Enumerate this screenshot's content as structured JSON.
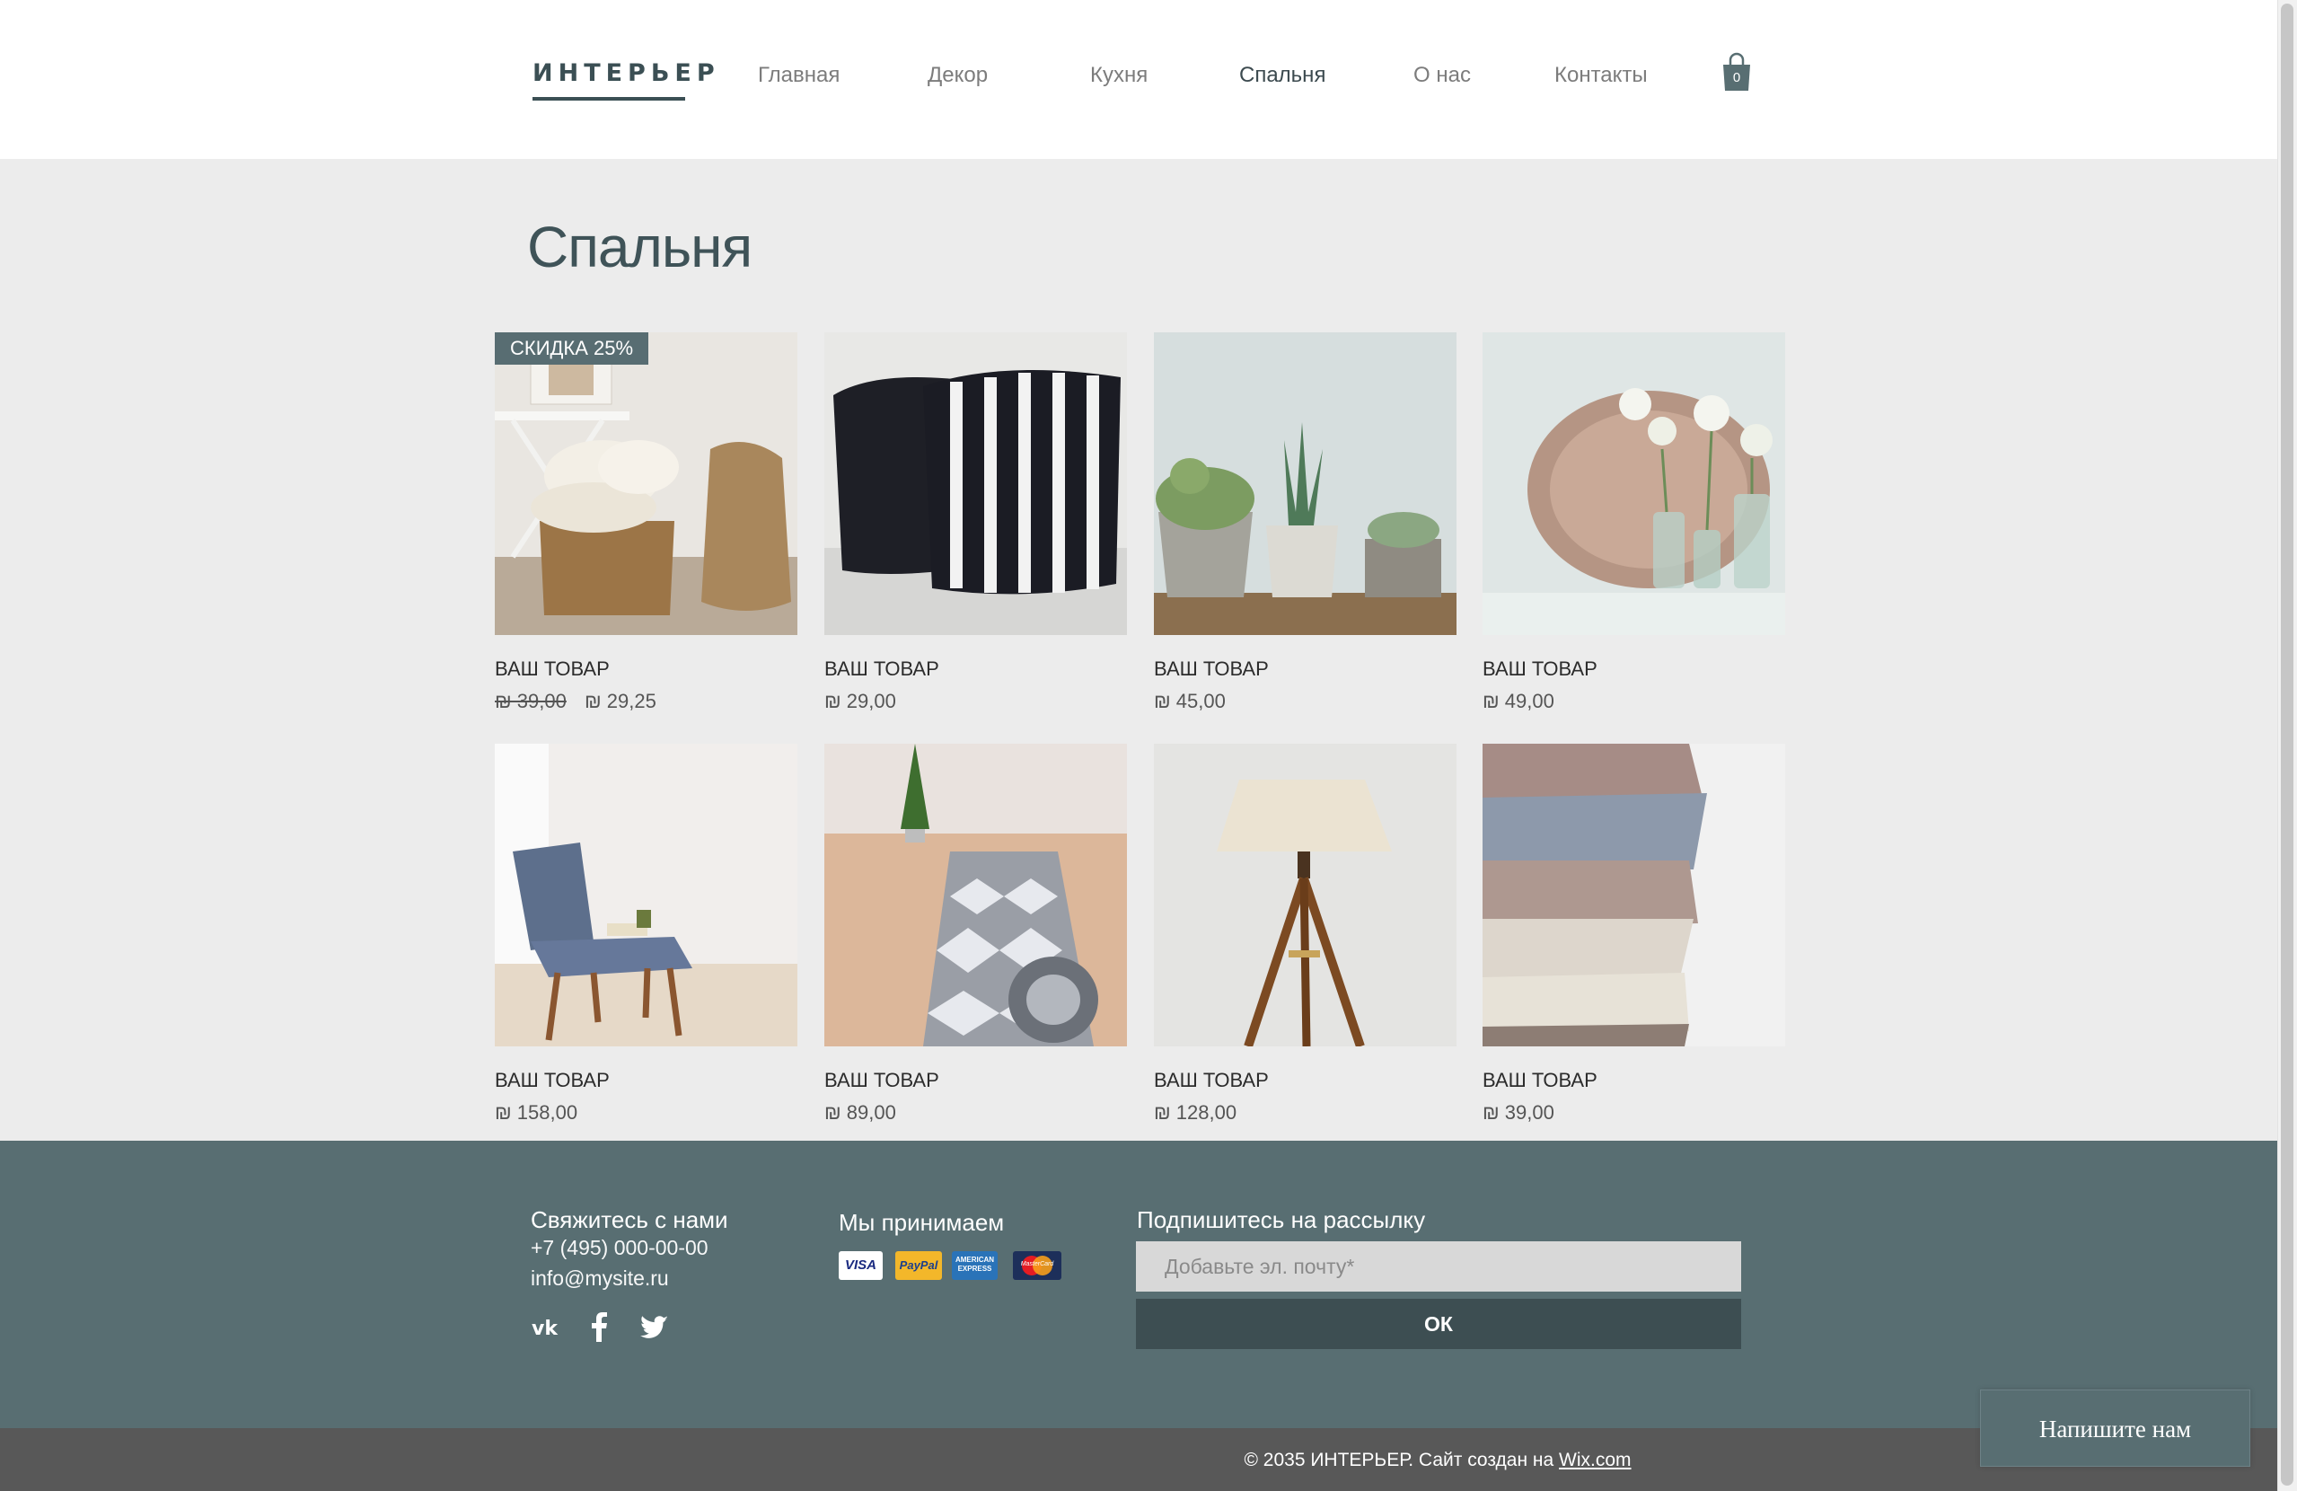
{
  "header": {
    "logo": "ИНТЕРЬЕР",
    "nav": [
      "Главная",
      "Декор",
      "Кухня",
      "Спальня",
      "О нас",
      "Контакты"
    ],
    "active_nav": "Спальня",
    "cart_count": "0"
  },
  "main": {
    "title": "Спальня",
    "products": [
      {
        "name": "ВАШ ТОВАР",
        "old_price": "₪ 39,00",
        "price": "₪ 29,25",
        "badge": "СКИДКА 25%",
        "image": "baskets-with-towels"
      },
      {
        "name": "ВАШ ТОВАР",
        "price": "₪ 29,00",
        "image": "striped-pillows"
      },
      {
        "name": "ВАШ ТОВАР",
        "price": "₪ 45,00",
        "image": "potted-succulents"
      },
      {
        "name": "ВАШ ТОВАР",
        "price": "₪ 49,00",
        "image": "flowers-and-tray"
      },
      {
        "name": "ВАШ ТОВАР",
        "price": "₪ 158,00",
        "image": "grey-chair"
      },
      {
        "name": "ВАШ ТОВАР",
        "price": "₪ 89,00",
        "image": "rolled-rug"
      },
      {
        "name": "ВАШ ТОВАР",
        "price": "₪ 128,00",
        "image": "tripod-lamp"
      },
      {
        "name": "ВАШ ТОВАР",
        "price": "₪ 39,00",
        "image": "knitted-blankets"
      }
    ]
  },
  "footer": {
    "contact_title": "Свяжитесь с нами",
    "phone": "+7 (495) 000-00-00",
    "email": "info@mysite.ru",
    "social": [
      "vk-icon",
      "facebook-icon",
      "twitter-icon"
    ],
    "payment_title": "Мы принимаем",
    "payment_methods": [
      "VISA",
      "PayPal",
      "AMERICAN EXPRESS",
      "MasterCard"
    ],
    "newsletter_title": "Подпишитесь на рассылку",
    "newsletter_placeholder": "Добавьте эл. почту*",
    "ok_label": "ОК",
    "copyright": "© 2035 ИНТЕРЬЕР. Сайт создан на",
    "copyright_link": "Wix.com"
  },
  "chat": {
    "label": "Напишите нам"
  },
  "colors": {
    "accent": "#586e72",
    "dark": "#3d4e52",
    "title": "#3f5358"
  }
}
